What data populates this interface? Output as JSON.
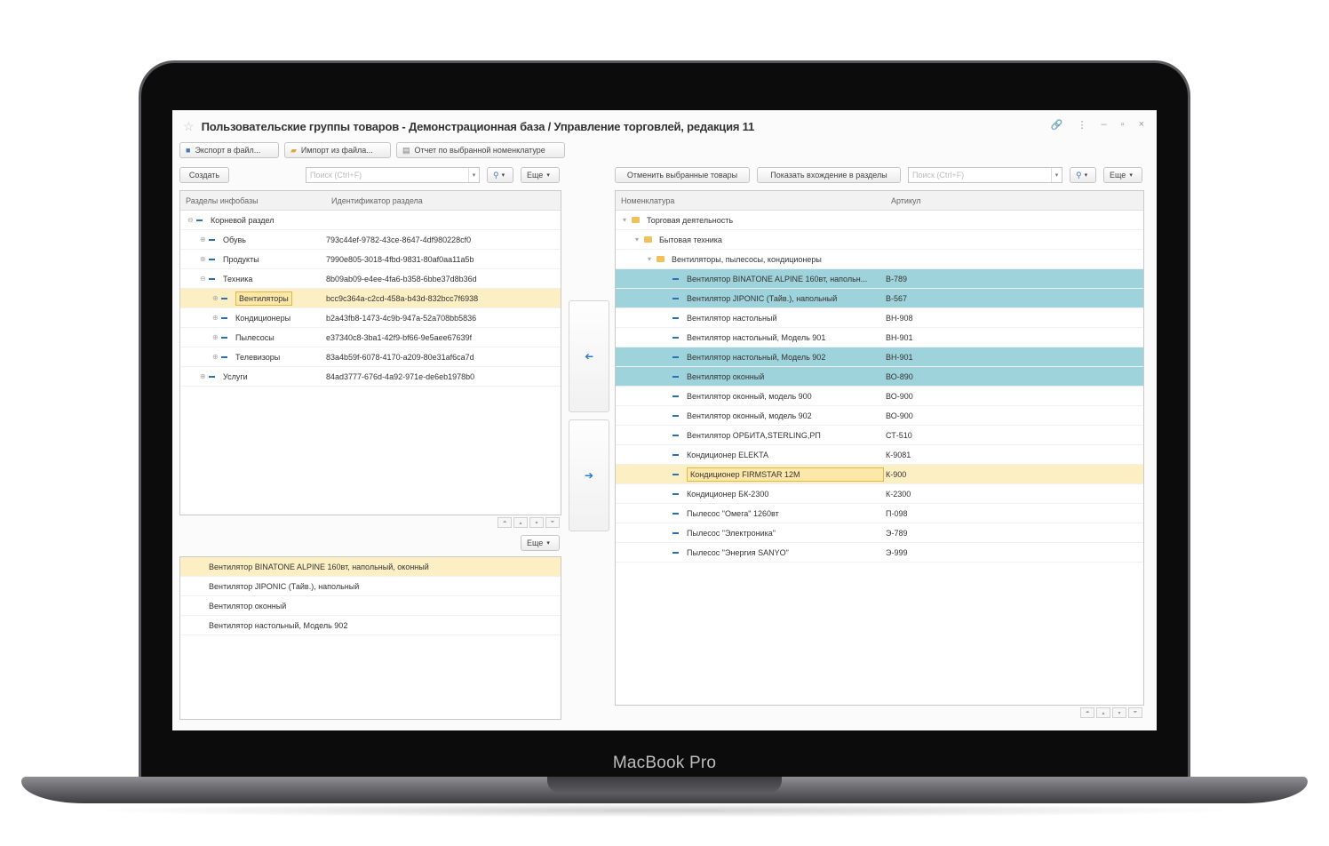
{
  "device": {
    "label": "MacBook Pro"
  },
  "window": {
    "title": "Пользовательские группы товаров - Демонстрационная база / Управление торговлей, редакция 11",
    "controls": [
      "🔗",
      "⋮",
      "–",
      "▫",
      "×"
    ]
  },
  "toolbar": {
    "export_label": "Экспорт в файл...",
    "import_label": "Импорт из файла...",
    "report_label": "Отчет по выбранной номенклатуре"
  },
  "left": {
    "create_label": "Создать",
    "search_placeholder": "Поиск (Ctrl+F)",
    "more_label": "Еще",
    "headers": [
      "Разделы инфобазы",
      "Идентификатор раздела"
    ],
    "tree": [
      {
        "name": "Корневой раздел",
        "id": "",
        "level": 0,
        "expander": "⊖"
      },
      {
        "name": "Обувь",
        "id": "793c44ef-9782-43ce-8647-4df980228cf0",
        "level": 1,
        "expander": "⊕"
      },
      {
        "name": "Продукты",
        "id": "7990e805-3018-4fbd-9831-80af0aa11a5b",
        "level": 1,
        "expander": "⊕"
      },
      {
        "name": "Техника",
        "id": "8b09ab09-e4ee-4fa6-b358-6bbe37d8b36d",
        "level": 1,
        "expander": "⊖"
      },
      {
        "name": "Вентиляторы",
        "id": "bcc9c364a-c2cd-458a-b43d-832bcc7f6938",
        "level": 2,
        "expander": "⊕",
        "selected": true
      },
      {
        "name": "Кондиционеры",
        "id": "b2a43fb8-1473-4c9b-947a-52a708bb5836",
        "level": 2,
        "expander": "⊕"
      },
      {
        "name": "Пылесосы",
        "id": "e37340c8-3ba1-42f9-bf66-9e5aee67639f",
        "level": 2,
        "expander": "⊕"
      },
      {
        "name": "Телевизоры",
        "id": "83a4b59f-6078-4170-a209-80e31af6ca7d",
        "level": 2,
        "expander": "⊕"
      },
      {
        "name": "Услуги",
        "id": "84ad3777-676d-4a92-971e-de6eb1978b0",
        "level": 1,
        "expander": "⊕"
      }
    ],
    "bottom_more_label": "Еще",
    "items": [
      {
        "text": "Вентилятор BINATONE ALPINE 160вт, напольный, оконный",
        "selected": true
      },
      {
        "text": "Вентилятор JIPONIC (Тайв.), напольный"
      },
      {
        "text": "Вентилятор оконный"
      },
      {
        "text": "Вентилятор настольный, Модель 902"
      }
    ]
  },
  "middle": {
    "right_arrow": "➔",
    "left_arrow": "➔"
  },
  "right": {
    "mark_label": "Отменить выбранные товары",
    "show_label": "Показать вхождение в разделы",
    "search_placeholder": "Поиск (Ctrl+F)",
    "more_label": "Еще",
    "headers": [
      "Номенклатура",
      "Артикул"
    ],
    "groups": [
      {
        "name": "Торговая деятельность",
        "level": 0
      },
      {
        "name": "Бытовая техника",
        "level": 1
      },
      {
        "name": "Вентиляторы, пылесосы, кондиционеры",
        "level": 2
      }
    ],
    "items": [
      {
        "name": "Вентилятор BINATONE ALPINE 160вт, напольн...",
        "article": "B-789",
        "state": "mark"
      },
      {
        "name": "Вентилятор JIPONIC (Тайв.), напольный",
        "article": "B-567",
        "state": "mark"
      },
      {
        "name": "Вентилятор настольный",
        "article": "ВН-908",
        "state": ""
      },
      {
        "name": "Вентилятор настольный, Модель 901",
        "article": "ВН-901",
        "state": ""
      },
      {
        "name": "Вентилятор настольный, Модель 902",
        "article": "ВН-901",
        "state": "mark"
      },
      {
        "name": "Вентилятор оконный",
        "article": "ВО-890",
        "state": "mark"
      },
      {
        "name": "Вентилятор оконный, модель 900",
        "article": "ВО-900",
        "state": ""
      },
      {
        "name": "Вентилятор оконный, модель 902",
        "article": "ВО-900",
        "state": ""
      },
      {
        "name": "Вентилятор ОРБИТА,STERLING,РП",
        "article": "СТ-510",
        "state": ""
      },
      {
        "name": "Кондиционер ELEKTA",
        "article": "К-9081",
        "state": ""
      },
      {
        "name": "Кондиционер FIRMSTAR 12M",
        "article": "К-900",
        "state": "sel"
      },
      {
        "name": "Кондиционер БК-2300",
        "article": "К-2300",
        "state": ""
      },
      {
        "name": "Пылесос \"Омега\" 1260вт",
        "article": "П-098",
        "state": ""
      },
      {
        "name": "Пылесос \"Электроника\"",
        "article": "Э-789",
        "state": ""
      },
      {
        "name": "Пылесос \"Энергия SANYO\"",
        "article": "Э-999",
        "state": ""
      }
    ]
  },
  "colors": {
    "selected": "#fdefc4",
    "marked": "#9fd3db",
    "accent": "#2b6fb4"
  }
}
